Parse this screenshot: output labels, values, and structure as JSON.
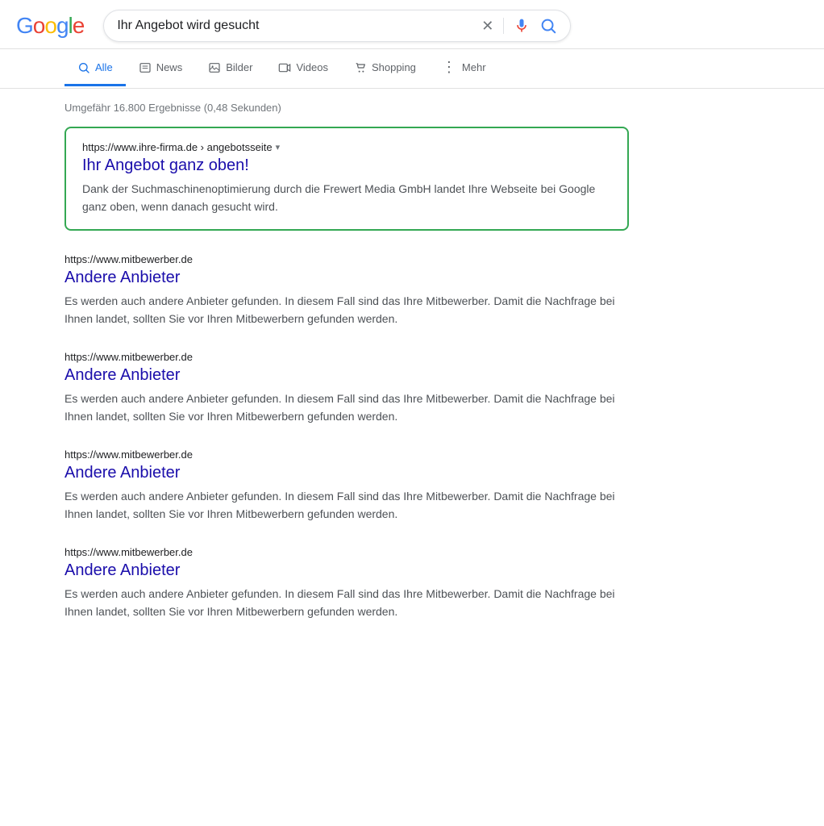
{
  "header": {
    "logo": "Google",
    "logo_parts": [
      "G",
      "o",
      "o",
      "g",
      "l",
      "e"
    ],
    "search_query": "Ihr Angebot wird gesucht",
    "clear_icon": "✕"
  },
  "nav": {
    "tabs": [
      {
        "id": "alle",
        "label": "Alle",
        "active": true
      },
      {
        "id": "news",
        "label": "News",
        "active": false
      },
      {
        "id": "bilder",
        "label": "Bilder",
        "active": false
      },
      {
        "id": "videos",
        "label": "Videos",
        "active": false
      },
      {
        "id": "shopping",
        "label": "Shopping",
        "active": false
      },
      {
        "id": "mehr",
        "label": "Mehr",
        "active": false
      }
    ]
  },
  "results": {
    "count_text": "Umgefähr 16.800 Ergebnisse (0,48 Sekunden)",
    "featured": {
      "url": "https://www.ihre-firma.de › angebotsseite",
      "title": "Ihr Angebot ganz oben!",
      "snippet": "Dank der Suchmaschinenoptimierung durch die Frewert Media GmbH landet Ihre Webseite bei Google ganz oben, wenn danach gesucht wird."
    },
    "items": [
      {
        "url": "https://www.mitbewerber.de",
        "title": "Andere Anbieter",
        "snippet": "Es werden auch andere Anbieter gefunden. In diesem Fall sind das Ihre Mitbewerber. Damit die Nachfrage bei Ihnen landet, sollten Sie vor Ihren Mitbewerbern gefunden werden."
      },
      {
        "url": "https://www.mitbewerber.de",
        "title": "Andere Anbieter",
        "snippet": "Es werden auch andere Anbieter gefunden. In diesem Fall sind das Ihre Mitbewerber. Damit die Nachfrage bei Ihnen landet, sollten Sie vor Ihren Mitbewerbern gefunden werden."
      },
      {
        "url": "https://www.mitbewerber.de",
        "title": "Andere Anbieter",
        "snippet": "Es werden auch andere Anbieter gefunden. In diesem Fall sind das Ihre Mitbewerber. Damit die Nachfrage bei Ihnen landet, sollten Sie vor Ihren Mitbewerbern gefunden werden."
      },
      {
        "url": "https://www.mitbewerber.de",
        "title": "Andere Anbieter",
        "snippet": "Es werden auch andere Anbieter gefunden. In diesem Fall sind das Ihre Mitbewerber. Damit die Nachfrage bei Ihnen landet, sollten Sie vor Ihren Mitbewerbern gefunden werden."
      }
    ]
  }
}
